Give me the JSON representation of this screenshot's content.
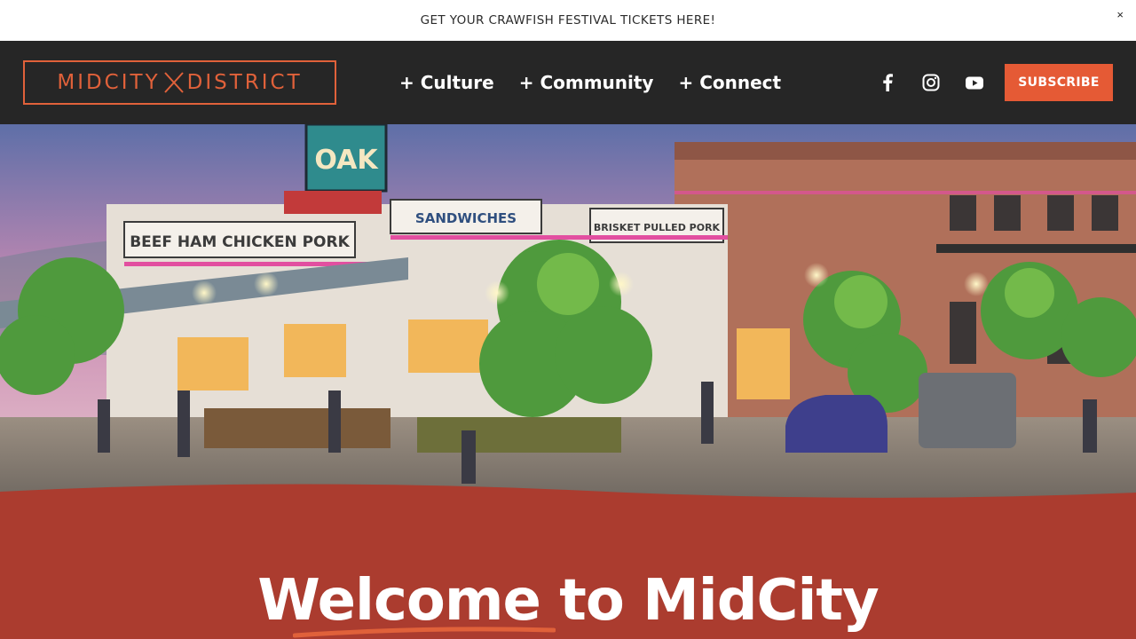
{
  "announcement": {
    "text": "GET YOUR CRAWFISH FESTIVAL TICKETS HERE!",
    "close_symbol": "×"
  },
  "brand": {
    "left": "MIDCITY",
    "right": "DISTRICT",
    "accent_color": "#e0613a"
  },
  "nav": {
    "items": [
      {
        "label": "+ Culture"
      },
      {
        "label": "+ Community"
      },
      {
        "label": "+ Connect"
      }
    ]
  },
  "social": {
    "icons": [
      "facebook-icon",
      "instagram-icon",
      "youtube-icon"
    ]
  },
  "subscribe": {
    "label": "SUBSCRIBE",
    "color": "#e55a35"
  },
  "hero": {
    "signs": [
      "OAK",
      "BEEF HAM CHICKEN PORK",
      "SANDWICHES",
      "BRISKET PULLED PORK"
    ]
  },
  "welcome": {
    "title": "Welcome to MidCity",
    "background": "#ab3c2f"
  },
  "colors": {
    "header_bg": "#262626",
    "announce_bg": "#ffffff"
  }
}
